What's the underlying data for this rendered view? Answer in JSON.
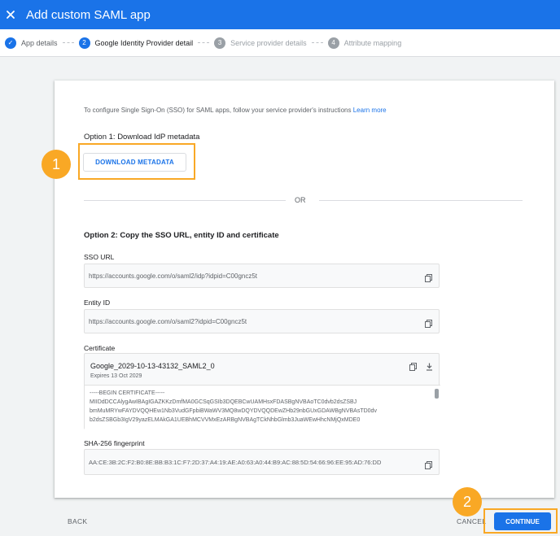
{
  "header": {
    "title": "Add custom SAML app"
  },
  "stepper": {
    "steps": [
      {
        "number": "✓",
        "label": "App details",
        "state": "done"
      },
      {
        "number": "2",
        "label": "Google Identity Provider detail",
        "state": "active"
      },
      {
        "number": "3",
        "label": "Service provider details",
        "state": "todo"
      },
      {
        "number": "4",
        "label": "Attribute mapping",
        "state": "todo"
      }
    ]
  },
  "intro": {
    "text": "To configure Single Sign-On (SSO) for SAML apps, follow your service provider's instructions",
    "link": "Learn more"
  },
  "option1": {
    "heading": "Option 1: Download IdP metadata",
    "button": "DOWNLOAD METADATA"
  },
  "divider": {
    "text": "OR"
  },
  "option2": {
    "heading": "Option 2: Copy the SSO URL, entity ID and certificate",
    "sso_label": "SSO URL",
    "sso_value": "https://accounts.google.com/o/saml2/idp?idpid=C00gncz5t",
    "entity_label": "Entity ID",
    "entity_value": "https://accounts.google.com/o/saml2?idpid=C00gncz5t",
    "cert_label": "Certificate",
    "cert_name": "Google_2029-10-13-43132_SAML2_0",
    "cert_expires": "Expires 13 Oct 2029",
    "cert_lines": [
      "-----BEGIN CERTIFICATE-----",
      "MIIDdDCCAlygAwIBAgIGAZKKzDmfMA0GCSqGSIb3DQEBCwUAMHsxFDASBgNVBAoTC0dvb2dsZSBJ",
      "bmMuMRYwFAYDVQQHEw1Nb3VudGFpbiBWaWV3MQ8wDQYDVQQDEwZHb29nbGUxGDAWBgNVBAsTD0dv",
      "b2dsZSBGb3IgV29yazELMAkGA1UEBhMCVVMxEzARBgNVBAgTCkNhbGlmb3JuaWEwHhcNMjQxMDE0"
    ],
    "fp_label": "SHA-256 fingerprint",
    "fp_value": "AA:CE:3B:2C:F2:B0:8E:BB:B3:1C:F7:2D:37:A4:19:AE:A0:63:A0:44:B9:AC:88:5D:54:66:96:EE:95:AD:76:DD"
  },
  "footer": {
    "back": "BACK",
    "cancel": "CANCEL",
    "continue": "CONTINUE"
  },
  "badges": {
    "one": "1",
    "two": "2"
  },
  "colors": {
    "primary": "#1a73e8",
    "highlight": "#f9a825"
  }
}
